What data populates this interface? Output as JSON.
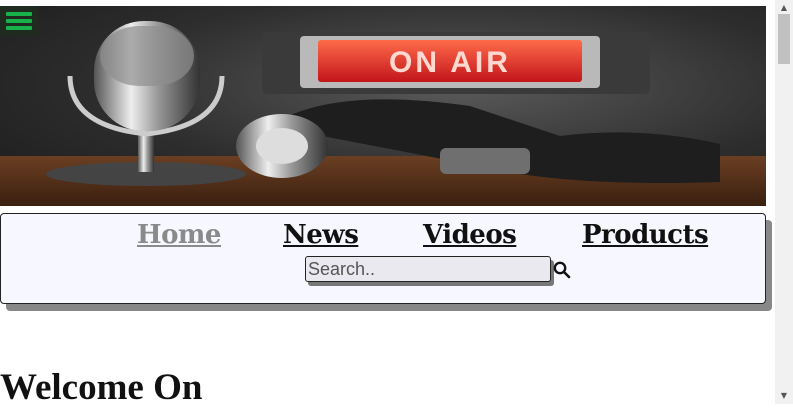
{
  "hero": {
    "sign_text": "ON AIR"
  },
  "nav": {
    "links": [
      {
        "label": "Home",
        "active": true
      },
      {
        "label": "News"
      },
      {
        "label": "Videos "
      },
      {
        "label": "Products"
      }
    ],
    "search_placeholder": "Search.."
  },
  "main": {
    "heading": "Welcome On"
  },
  "icons": {
    "menu": "hamburger-menu-icon",
    "search": "magnifier-search-icon"
  },
  "colors": {
    "menu_icon": "#17b34a",
    "nav_background": "#f7f8ff",
    "active_link": "#8a8a8a",
    "sign_red": "#e3262a"
  }
}
